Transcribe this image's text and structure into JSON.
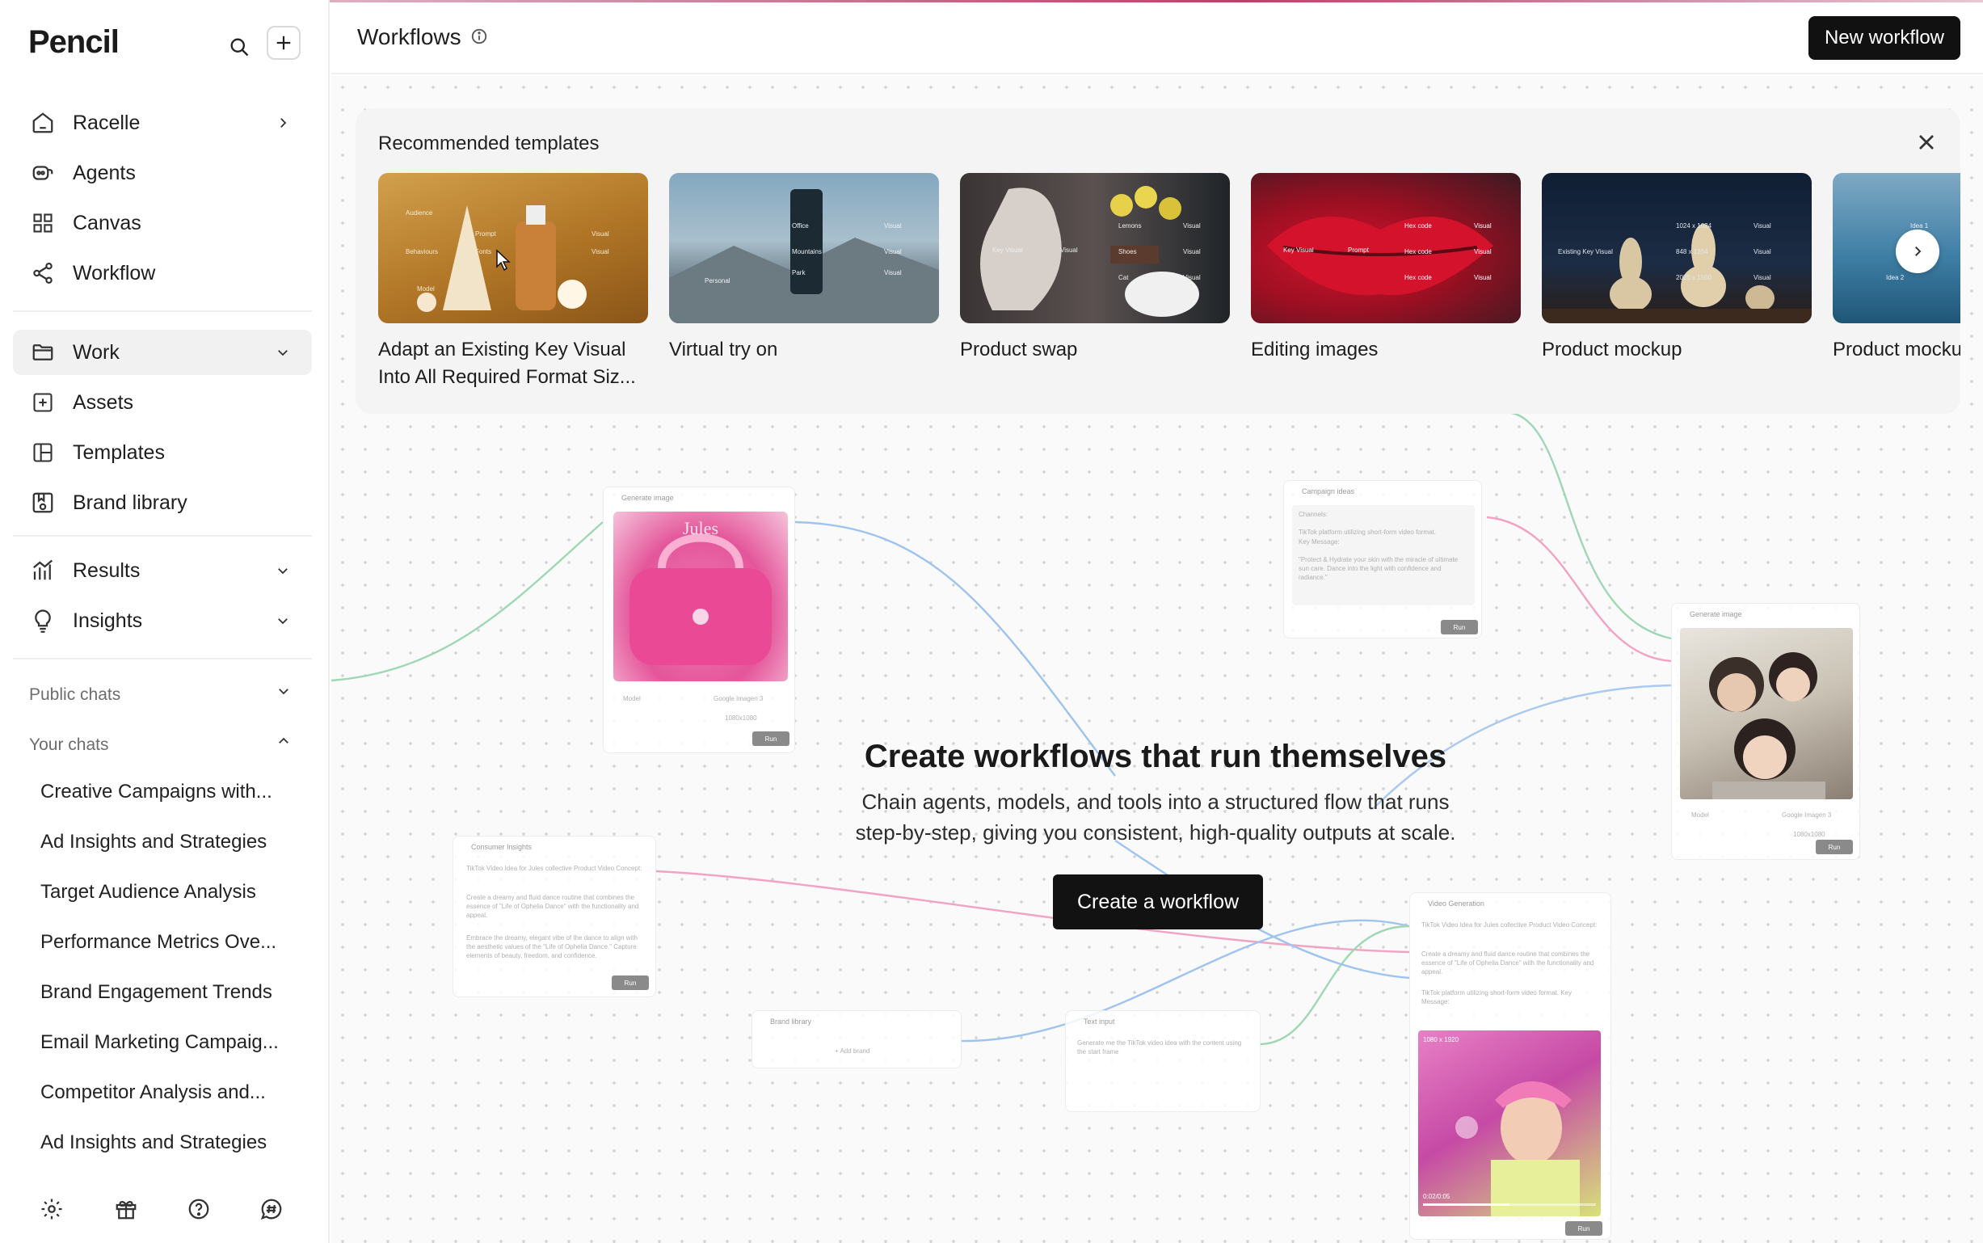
{
  "app": {
    "name": "Pencil"
  },
  "sidebar": {
    "primary": [
      {
        "label": "Racelle",
        "icon": "home-icon"
      },
      {
        "label": "Agents",
        "icon": "agents-icon"
      },
      {
        "label": "Canvas",
        "icon": "grid-icon"
      },
      {
        "label": "Workflow",
        "icon": "workflow-icon"
      }
    ],
    "work": [
      {
        "label": "Work",
        "icon": "folder-icon"
      },
      {
        "label": "Assets",
        "icon": "assets-icon"
      },
      {
        "label": "Templates",
        "icon": "templates-icon"
      },
      {
        "label": "Brand library",
        "icon": "brand-library-icon"
      }
    ],
    "analytics": [
      {
        "label": "Results",
        "icon": "chart-icon"
      },
      {
        "label": "Insights",
        "icon": "lightbulb-icon"
      }
    ],
    "public_chats_label": "Public chats",
    "your_chats_label": "Your chats",
    "chats": [
      "Creative Campaigns with...",
      "Ad Insights and Strategies",
      "Target Audience Analysis",
      "Performance Metrics Ove...",
      "Brand Engagement Trends",
      "Email Marketing Campaig...",
      "Competitor Analysis and...",
      "Ad Insights and Strategies"
    ]
  },
  "header": {
    "title": "Workflows",
    "new_button": "New workflow"
  },
  "templates": {
    "title": "Recommended templates",
    "items": [
      {
        "label": "Adapt an Existing Key Visual Into All Required Format Siz...",
        "tags": [
          "Audience",
          "Behaviours",
          "Prompt",
          "Fonts",
          "Visual",
          "Visual",
          "Model"
        ]
      },
      {
        "label": "Virtual try on",
        "tags": [
          "Personal",
          "Office",
          "Mountains",
          "Park",
          "Visual",
          "Visual",
          "Visual"
        ]
      },
      {
        "label": "Product swap",
        "tags": [
          "Key Visual",
          "Visual",
          "Lemons",
          "Shoes",
          "Cat",
          "Visual",
          "Visual",
          "Visual"
        ]
      },
      {
        "label": "Editing images",
        "tags": [
          "Key Visual",
          "Prompt",
          "Hex code",
          "Hex code",
          "Hex code",
          "Visual",
          "Visual",
          "Visual"
        ]
      },
      {
        "label": "Product mockup",
        "tags": [
          "Existing Key Visual",
          "1024 x 1024",
          "848 x 1264",
          "2025 x 1500",
          "Visual",
          "Visual",
          "Visual"
        ]
      },
      {
        "label": "Product mocku",
        "tags": [
          "Idea 1",
          "Idea 2"
        ]
      }
    ]
  },
  "nodes": {
    "generate_image_1": {
      "title": "Generate image",
      "image_text": "Jules",
      "model_label": "Model",
      "model_value": "Google Imagen 3",
      "size": "1080x1080",
      "run": "Run"
    },
    "campaign_ideas": {
      "title": "Campaign ideas",
      "channels": "Channels:",
      "line1": "TikTok platform utilizing short-form video format.",
      "line2": "Key Message:",
      "line3": "\"Protect & Hydrate your skin with the miracle of ultimate sun care. Dance into the light with confidence and radiance.\"",
      "run": "Run"
    },
    "generate_image_2": {
      "title": "Generate image",
      "model_label": "Model",
      "model_value": "Google Imagen 3",
      "size": "1080x1080",
      "run": "Run"
    },
    "consumer_insights": {
      "title": "Consumer Insights",
      "line1": "TikTok Video Idea for Jules collective Product Video Concept:",
      "line2": "Create a dreamy and fluid dance routine that combines the essence of \"Life of Ophelia Dance\" with the functionality and appeal.",
      "line3": "Embrace the dreamy, elegant vibe of the dance to align with the aesthetic values of the \"Life of Ophelia Dance.\" Capture elements of beauty, freedom, and confidence.",
      "run": "Run"
    },
    "brand_library": {
      "title": "Brand library",
      "add": "+ Add brand"
    },
    "text_input": {
      "title": "Text input",
      "text": "Generate me the TikTok video idea with the content using the start frame"
    },
    "video_generation": {
      "title": "Video Generation",
      "line1": "TikTok Video Idea for Jules collective Product Video Concept:",
      "line2": "Create a dreamy and fluid dance routine that combines the essence of \"Life of Ophelia Dance\" with the functionality and appeal.",
      "line3": "TikTok platform utilizing short-form video format. Key Message:",
      "size": "1080 x 1920",
      "time": "0:02/0:05",
      "run": "Run"
    }
  },
  "hero": {
    "title": "Create workflows that run themselves",
    "subtitle_line1": "Chain agents, models, and tools into a structured flow that runs",
    "subtitle_line2": "step-by-step, giving you consistent, high-quality outputs at scale.",
    "button": "Create a workflow"
  },
  "colors": {
    "accent": "#111111",
    "topline": "#b7436b",
    "edge_green": "#8fd0a8",
    "edge_pink": "#ef8fb4",
    "edge_blue": "#8cb8ea"
  }
}
